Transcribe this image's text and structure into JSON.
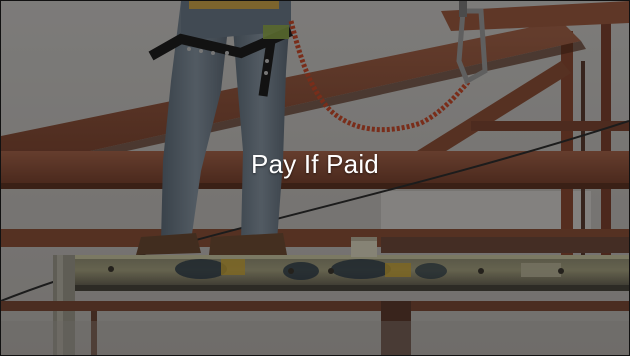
{
  "hero": {
    "title": "Pay If Paid",
    "overlay_color": "#000000",
    "text_color": "#ffffff",
    "image_subject": "construction-worker-on-steel-beam"
  }
}
